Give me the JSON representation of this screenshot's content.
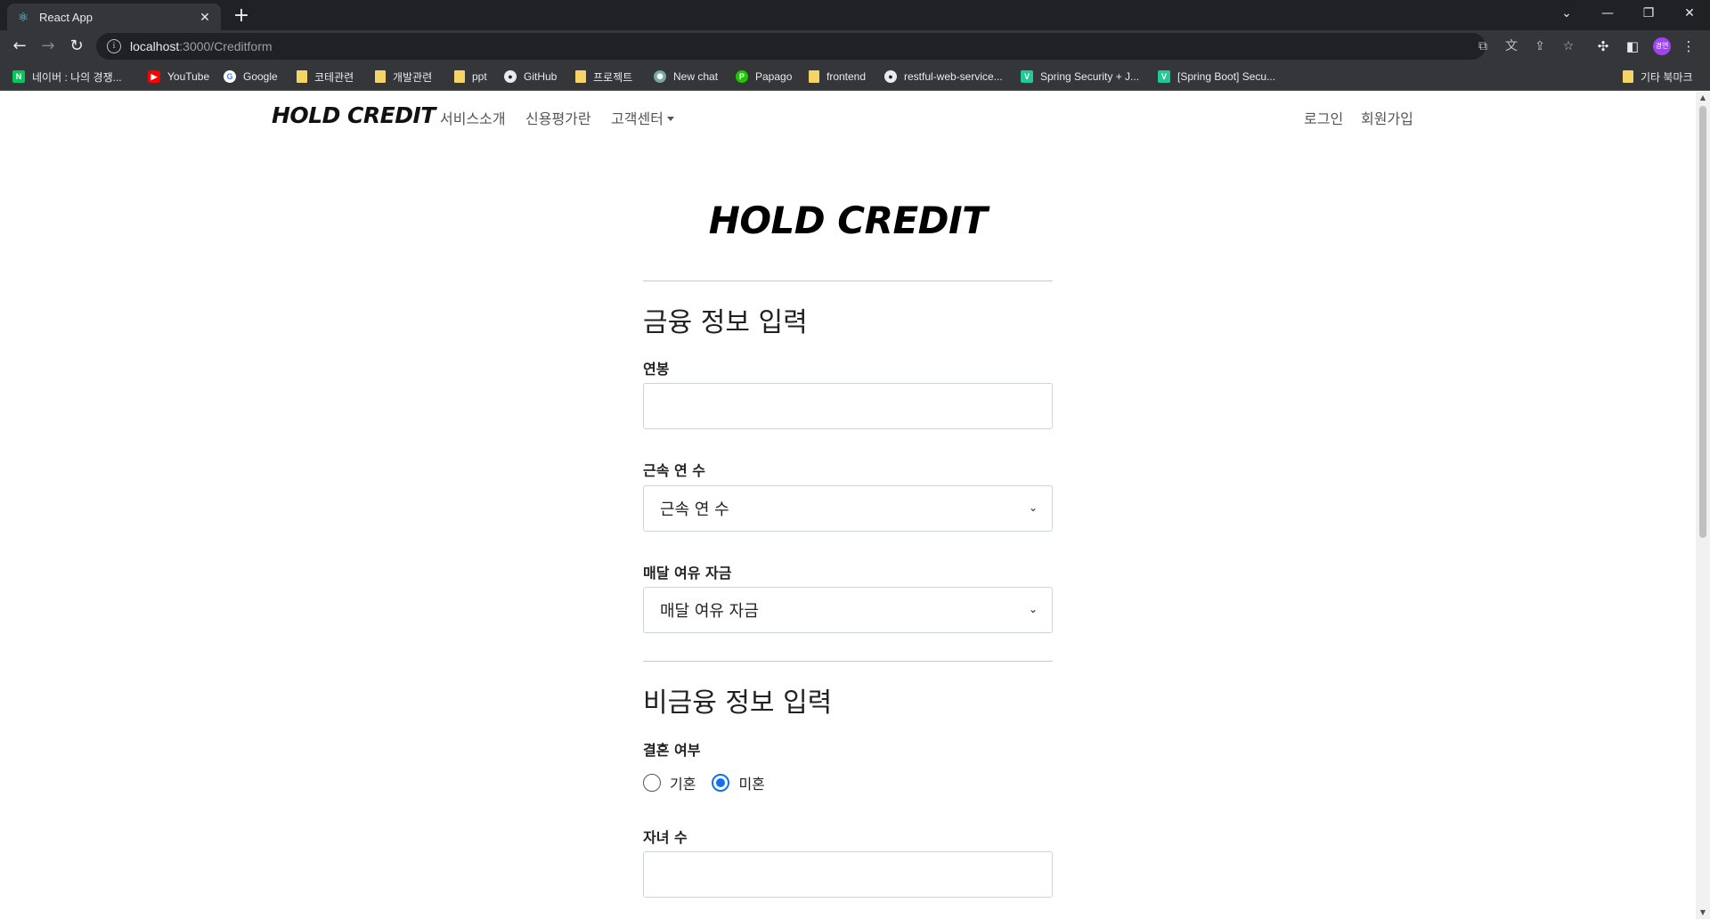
{
  "browser": {
    "tab_title": "React App",
    "url_host": "localhost",
    "url_path": ":3000/Creditform",
    "profile_initials": "경연"
  },
  "bookmarks": [
    {
      "label": "네이버 : 나의 경쟁...",
      "icon": "naver-icon"
    },
    {
      "label": "YouTube",
      "icon": "youtube-icon"
    },
    {
      "label": "Google",
      "icon": "google-icon"
    },
    {
      "label": "코테관련",
      "icon": "folder-icon"
    },
    {
      "label": "개발관련",
      "icon": "folder-icon"
    },
    {
      "label": "ppt",
      "icon": "folder-icon"
    },
    {
      "label": "GitHub",
      "icon": "github-icon"
    },
    {
      "label": "프로젝트",
      "icon": "folder-icon"
    },
    {
      "label": "New chat",
      "icon": "chatgpt-icon"
    },
    {
      "label": "Papago",
      "icon": "papago-icon"
    },
    {
      "label": "frontend",
      "icon": "folder-icon"
    },
    {
      "label": "restful-web-service...",
      "icon": "github-icon"
    },
    {
      "label": "Spring Security + J...",
      "icon": "velog-icon"
    },
    {
      "label": "[Spring Boot] Secu...",
      "icon": "velog-icon"
    },
    {
      "label": "기타 북마크",
      "icon": "folder-icon"
    }
  ],
  "nav": {
    "brand": "HOLD CREDIT",
    "links": [
      "서비스소개",
      "신용평가란",
      "고객센터"
    ],
    "login": "로그인",
    "signup": "회원가입"
  },
  "form": {
    "hero": "HOLD CREDIT",
    "financial_title": "금융 정보 입력",
    "salary_label": "연봉",
    "salary_value": "",
    "tenure_label": "근속 연 수",
    "tenure_selected": "근속 연 수",
    "savings_label": "매달 여유 자금",
    "savings_selected": "매달 여유 자금",
    "nonfinancial_title": "비금융 정보 입력",
    "marriage_label": "결혼 여부",
    "marriage_options": [
      "기혼",
      "미혼"
    ],
    "marriage_selected": "미혼",
    "children_label": "자녀 수",
    "children_value": ""
  },
  "colors": {
    "accent": "#0d6efd",
    "chrome_dark": "#202124",
    "chrome_toolbar": "#35363a"
  }
}
